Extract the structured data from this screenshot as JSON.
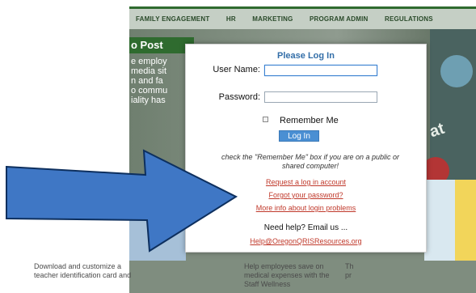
{
  "nav": {
    "items": [
      "FAMILY ENGAGEMENT",
      "HR",
      "MARKETING",
      "PROGRAM ADMIN",
      "REGULATIONS"
    ]
  },
  "hero": {
    "title": "o Post",
    "text_lines": [
      "e employ",
      "media sit",
      "n and fa",
      "o commu",
      "iality has"
    ],
    "decor_word": "at"
  },
  "cards": {
    "a": "Download and customize a teacher identification card and",
    "b": "Help employees save on medical expenses with the Staff Wellness",
    "c": "Th pr"
  },
  "login": {
    "heading": "Please Log In",
    "username_label": "User Name:",
    "password_label": "Password:",
    "username_value": "",
    "password_value": "",
    "remember_label": "Remember Me",
    "remember_checked": false,
    "button_label": "Log In",
    "note": "check the \"Remember Me\" box if you are on a public or shared computer!",
    "link_request": "Request a log in account",
    "link_forgot": "Forgot your password?",
    "link_more": "More info about login problems",
    "help_text": "Need help? Email us ...",
    "help_email": "Help@OregonQRISResources.org"
  },
  "colors": {
    "arrow": "#3f77c5",
    "link": "#c0392b",
    "heading": "#336ea8",
    "nav_accent": "#2f6b2f"
  },
  "icons": {
    "arrow": "big-arrow-icon"
  }
}
